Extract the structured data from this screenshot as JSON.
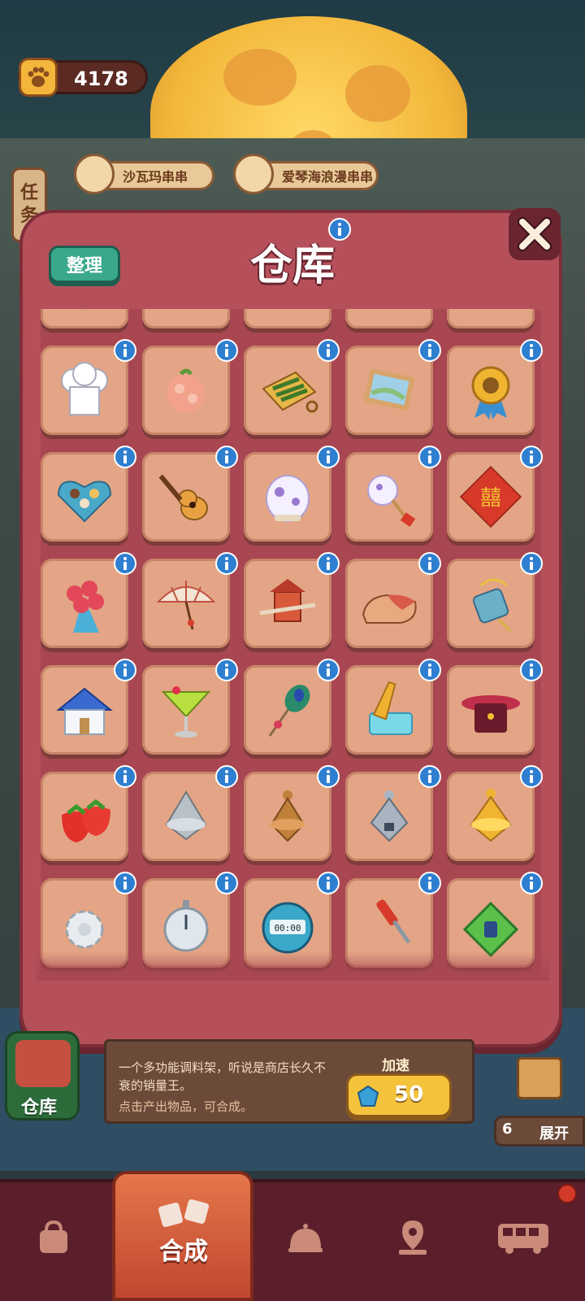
{
  "hud": {
    "currency_value": "4178",
    "currency_icon": "paw-icon",
    "task_tab_label_1": "任",
    "task_tab_label_2": "务",
    "orders": [
      {
        "label": "沙瓦玛串串"
      },
      {
        "label": "爱琴海浪漫串串"
      }
    ]
  },
  "modal": {
    "title": "仓库",
    "sort_label": "整理",
    "close_icon": "close-icon"
  },
  "items": [
    {
      "name": "energy-drink-icon"
    },
    {
      "name": "ink-bottle-icon"
    },
    {
      "name": "tires-icon"
    },
    {
      "name": "paper-stack-icon"
    },
    {
      "name": "green-bean-icon"
    },
    {
      "name": "chef-hat-icon"
    },
    {
      "name": "shrimp-ball-icon"
    },
    {
      "name": "vegetable-board-icon"
    },
    {
      "name": "puzzle-picture-icon"
    },
    {
      "name": "gold-medal-icon"
    },
    {
      "name": "chocolate-box-icon"
    },
    {
      "name": "guitar-icon"
    },
    {
      "name": "porcelain-jar-icon"
    },
    {
      "name": "porcelain-fan-icon"
    },
    {
      "name": "double-happiness-icon"
    },
    {
      "name": "rose-bouquet-icon"
    },
    {
      "name": "paper-umbrella-icon"
    },
    {
      "name": "sedan-chair-icon"
    },
    {
      "name": "slipper-icon"
    },
    {
      "name": "jade-pendant-icon"
    },
    {
      "name": "blue-house-icon"
    },
    {
      "name": "cocktail-icon"
    },
    {
      "name": "peacock-feather-icon"
    },
    {
      "name": "ice-sword-icon"
    },
    {
      "name": "magic-hat-icon"
    },
    {
      "name": "strawberries-icon"
    },
    {
      "name": "silver-top-icon"
    },
    {
      "name": "bronze-top-icon"
    },
    {
      "name": "steel-top-icon"
    },
    {
      "name": "gold-top-icon"
    },
    {
      "name": "gear-icon"
    },
    {
      "name": "stopwatch-icon"
    },
    {
      "name": "timer-clock-icon"
    },
    {
      "name": "screwdriver-icon"
    },
    {
      "name": "green-badge-icon"
    }
  ],
  "info_panel": {
    "description": "一个多功能调料架，听说是商店长久不衰的销量王。",
    "hint": "点击产出物品，可合成。",
    "speed_label": "加速",
    "speed_cost": "50",
    "warehouse_label": "仓库",
    "expand_count": "6",
    "expand_label": "展开"
  },
  "nav": {
    "active_label": "合成",
    "items": [
      {
        "name": "bag-icon"
      },
      {
        "name": "merge-icon"
      },
      {
        "name": "cloche-icon"
      },
      {
        "name": "map-icon"
      },
      {
        "name": "bus-icon"
      }
    ]
  },
  "colors": {
    "modal_bg": "#b5505a",
    "cell_bg": "#e3a585",
    "info_badge": "#2f7fd0",
    "sort_button": "#3aa88c"
  }
}
